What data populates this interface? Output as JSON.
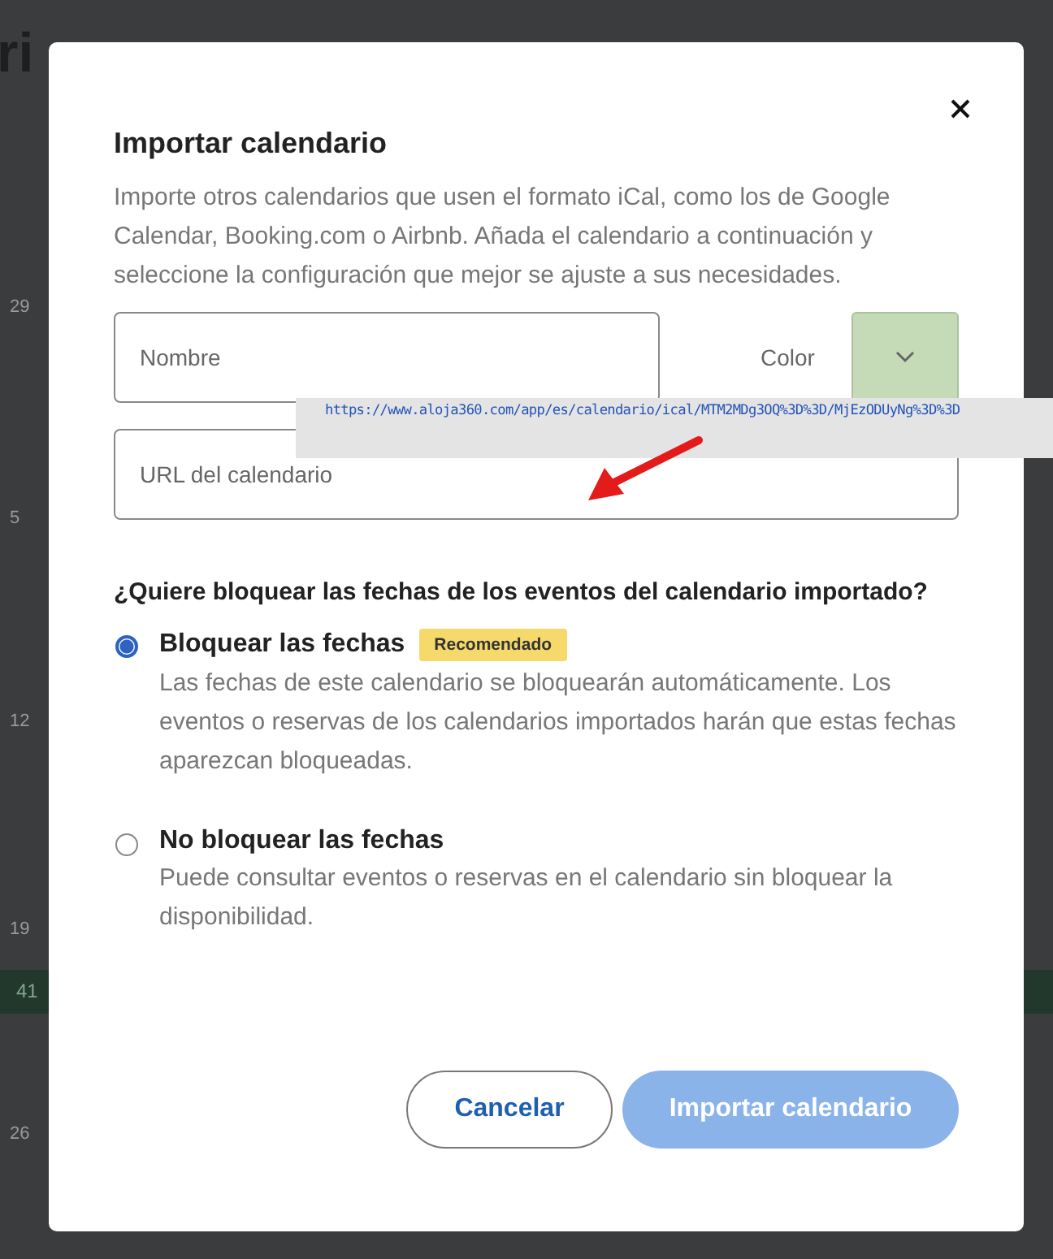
{
  "background": {
    "title_fragment": "ri",
    "day_numbers": [
      "29",
      "5",
      "12",
      "19",
      "26"
    ],
    "event_bar": "41"
  },
  "dialog": {
    "title": "Importar calendario",
    "description": "Importe otros calendarios que usen el formato iCal, como los de Google Calendar, Booking.com o Airbnb. Añada el calendario a continuación y seleccione la configuración que mejor se ajuste a sus necesidades.",
    "name_field": {
      "placeholder": "Nombre"
    },
    "color_picker": {
      "label": "Color",
      "color": "#c5dbb8"
    },
    "url_field": {
      "placeholder": "URL del calendario"
    },
    "tooltip": {
      "link": "https://www.aloja360.com/app/es/calendario/ical/MTM2MDg3OQ%3D%3D/MjEzODUyNg%3D%3D"
    },
    "question": "¿Quiere bloquear las fechas de los eventos del calendario importado?",
    "options": [
      {
        "label": "Bloquear las fechas",
        "badge": "Recomendado",
        "description": "Las fechas de este calendario se bloquearán automáticamente. Los eventos o reservas de los calendarios importados harán que estas fechas aparezcan bloqueadas.",
        "selected": true
      },
      {
        "label": "No bloquear las fechas",
        "description": "Puede consultar eventos o reservas en el calendario sin bloquear la disponibilidad.",
        "selected": false
      }
    ],
    "buttons": [
      {
        "label": "Cancelar",
        "kind": "secondary"
      },
      {
        "label": "Importar calendario",
        "kind": "primary",
        "disabled": true
      }
    ]
  }
}
